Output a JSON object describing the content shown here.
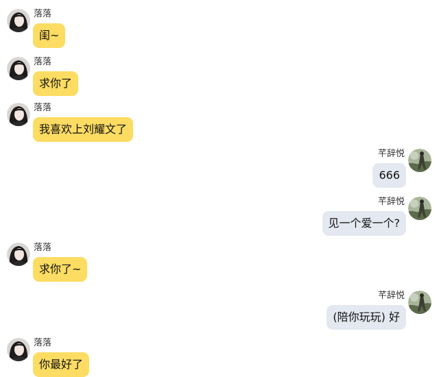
{
  "colors": {
    "incoming_bubble": "#fcdc63",
    "outgoing_bubble": "#e4e8f0",
    "background": "#ffffff"
  },
  "messages": [
    {
      "side": "left",
      "sender": "落落",
      "text": "闺~",
      "avatar": "girl-portrait-avatar"
    },
    {
      "side": "left",
      "sender": "落落",
      "text": "求你了",
      "avatar": "girl-portrait-avatar"
    },
    {
      "side": "left",
      "sender": "落落",
      "text": "我喜欢上刘耀文了",
      "avatar": "girl-portrait-avatar"
    },
    {
      "side": "right",
      "sender": "芊辞悦",
      "text": "666",
      "avatar": "green-photo-avatar"
    },
    {
      "side": "right",
      "sender": "芊辞悦",
      "text": "见一个爱一个?",
      "avatar": "green-photo-avatar"
    },
    {
      "side": "left",
      "sender": "落落",
      "text": "求你了~",
      "avatar": "girl-portrait-avatar"
    },
    {
      "side": "right",
      "sender": "芊辞悦",
      "text": "(陪你玩玩) 好",
      "avatar": "green-photo-avatar"
    },
    {
      "side": "left",
      "sender": "落落",
      "text": "你最好了",
      "avatar": "girl-portrait-avatar"
    }
  ]
}
